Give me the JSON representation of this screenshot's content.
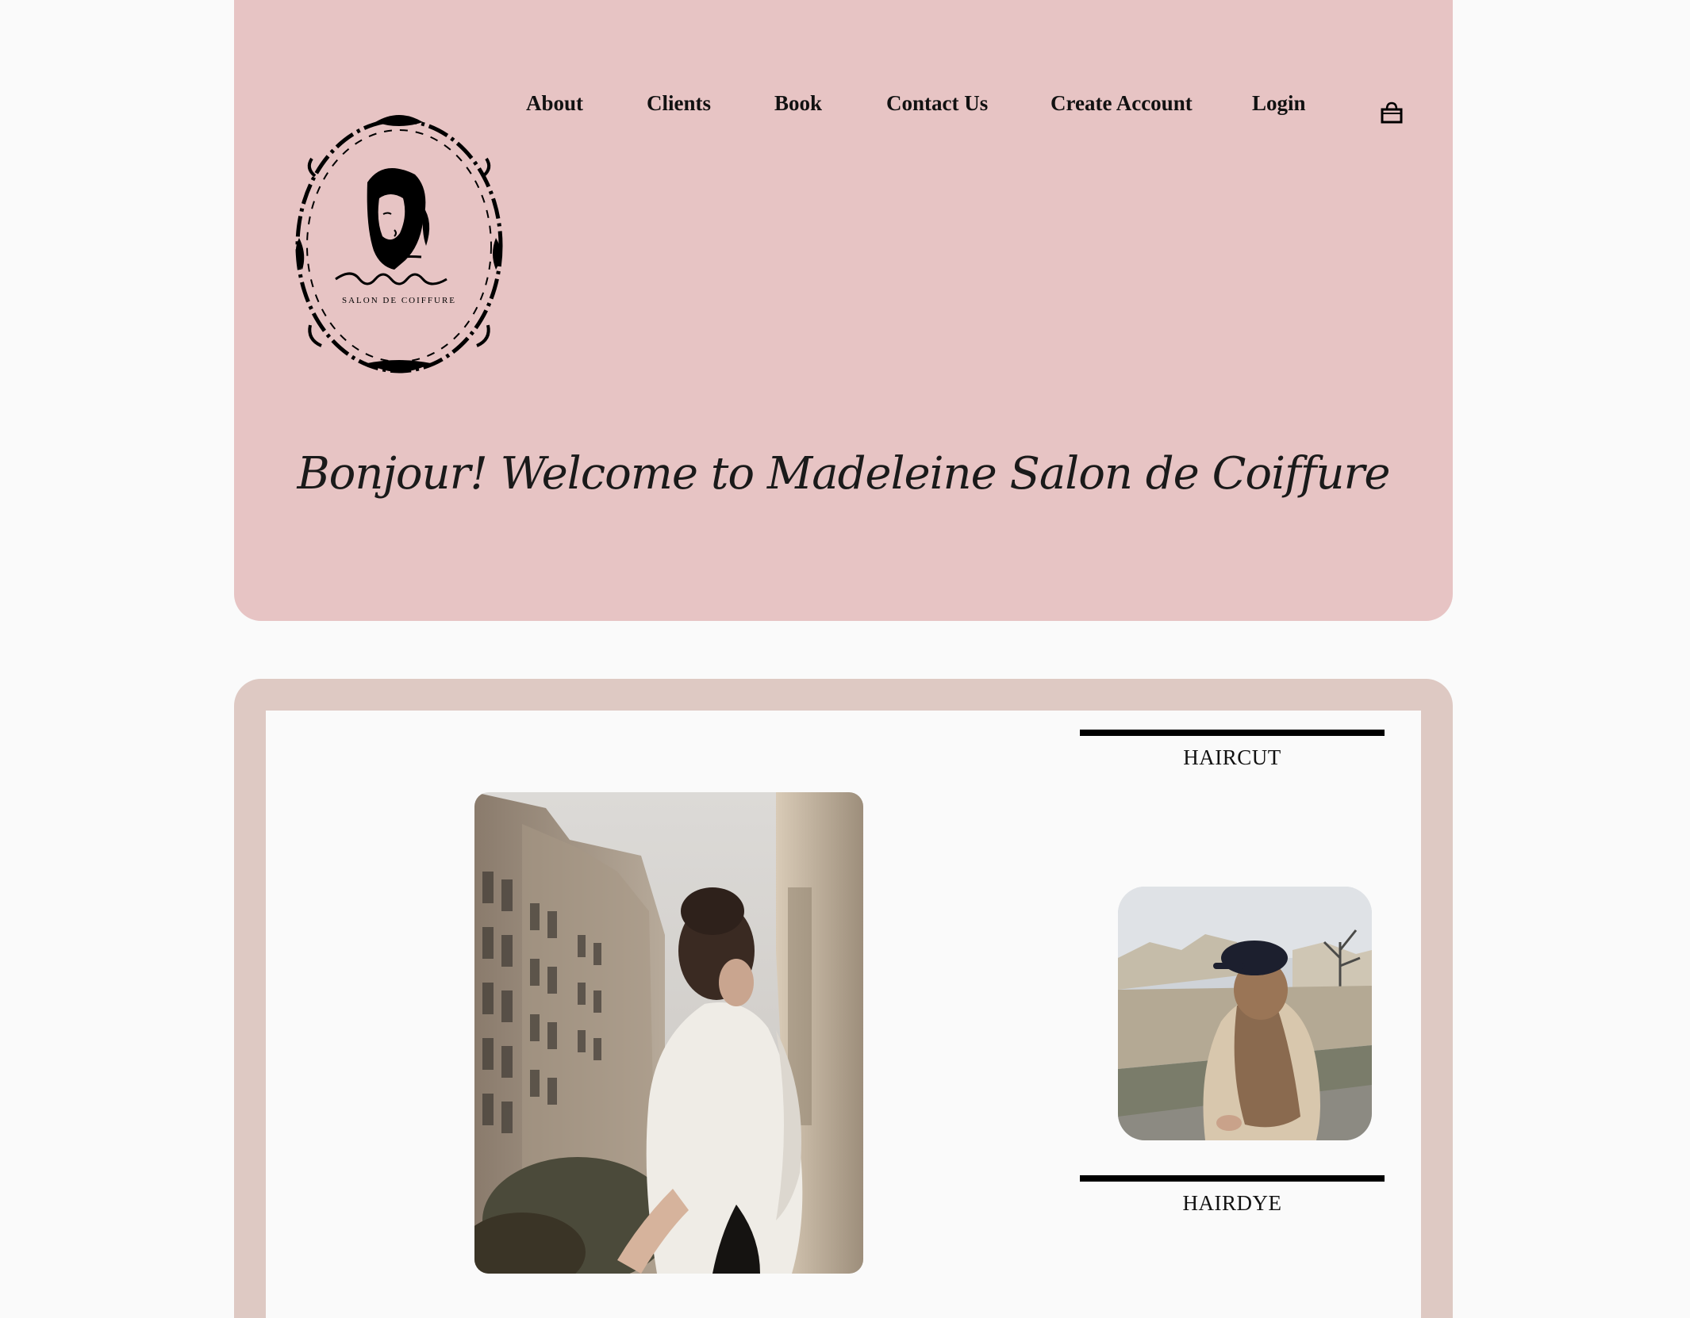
{
  "header": {
    "logo_alt": "Madeleine Salon de Coiffure logo",
    "logo_script": "Madeleine",
    "logo_caption": "SALON DE COIFFURE",
    "nav": [
      {
        "label": "About"
      },
      {
        "label": "Clients"
      },
      {
        "label": "Book"
      },
      {
        "label": "Contact Us"
      },
      {
        "label": "Create Account"
      },
      {
        "label": "Login"
      }
    ],
    "cart_icon": "shopping-bag-icon",
    "welcome": "Bonjour! Welcome to Madeleine Salon de Coiffure"
  },
  "colors": {
    "header_bg": "#e7c4c4",
    "content_border": "#dec9c3",
    "page_bg": "#fafafa",
    "text": "#111111"
  },
  "content": {
    "main_photo_alt": "Woman with updo looking out over Paris street",
    "services": [
      {
        "title": "HAIRCUT",
        "photo_alt": "Woman with long hair and cap by the Seine"
      },
      {
        "title": "HAIRDYE"
      }
    ]
  }
}
